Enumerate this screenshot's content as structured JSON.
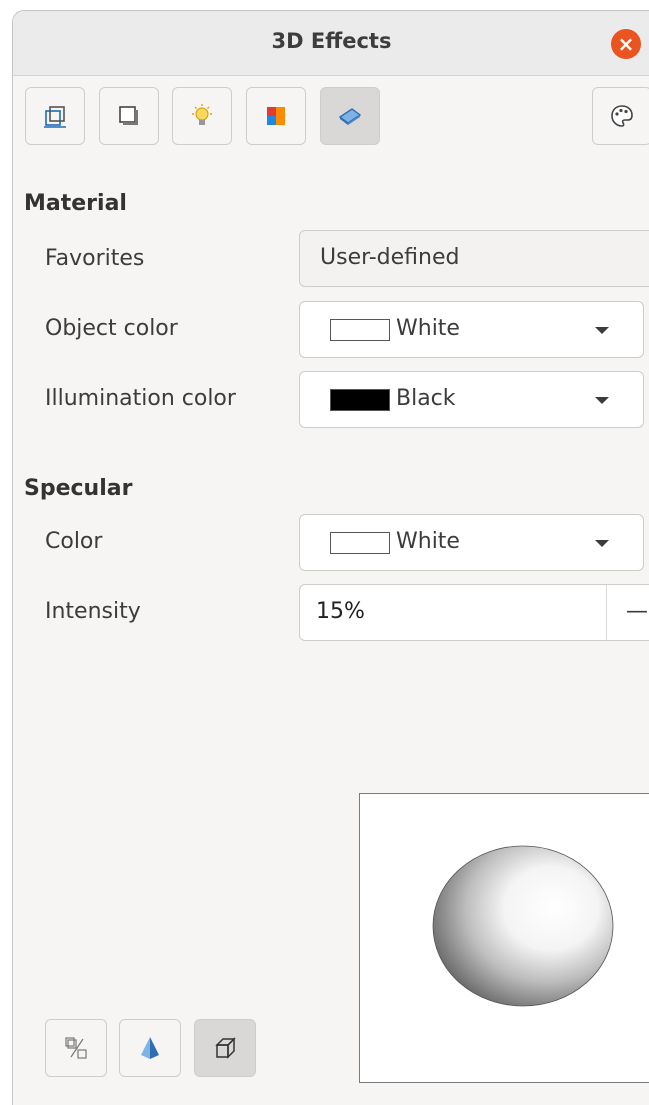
{
  "window": {
    "title": "3D Effects"
  },
  "material": {
    "heading": "Material",
    "favorites": {
      "label": "Favorites",
      "value": "User-defined"
    },
    "object_color": {
      "label": "Object color",
      "value": "White",
      "swatch": "#ffffff"
    },
    "illumination_color": {
      "label": "Illumination color",
      "value": "Black",
      "swatch": "#000000"
    }
  },
  "specular": {
    "heading": "Specular",
    "color": {
      "label": "Color",
      "value": "White",
      "swatch": "#ffffff"
    },
    "intensity": {
      "label": "Intensity",
      "value": "15%"
    }
  },
  "toolbar": {
    "icons": [
      "geometry-icon",
      "shading-icon",
      "illumination-icon",
      "textures-icon",
      "material-icon",
      "color-palette-icon"
    ],
    "active": "material-icon"
  },
  "bottom_toolbar": {
    "icons": [
      "convert-to-3d-icon",
      "convert-to-rotation-object-icon",
      "perspective-icon"
    ],
    "active": "perspective-icon"
  },
  "colors": {
    "close_button": "#e95420",
    "dialog_bg": "#f6f5f4"
  }
}
